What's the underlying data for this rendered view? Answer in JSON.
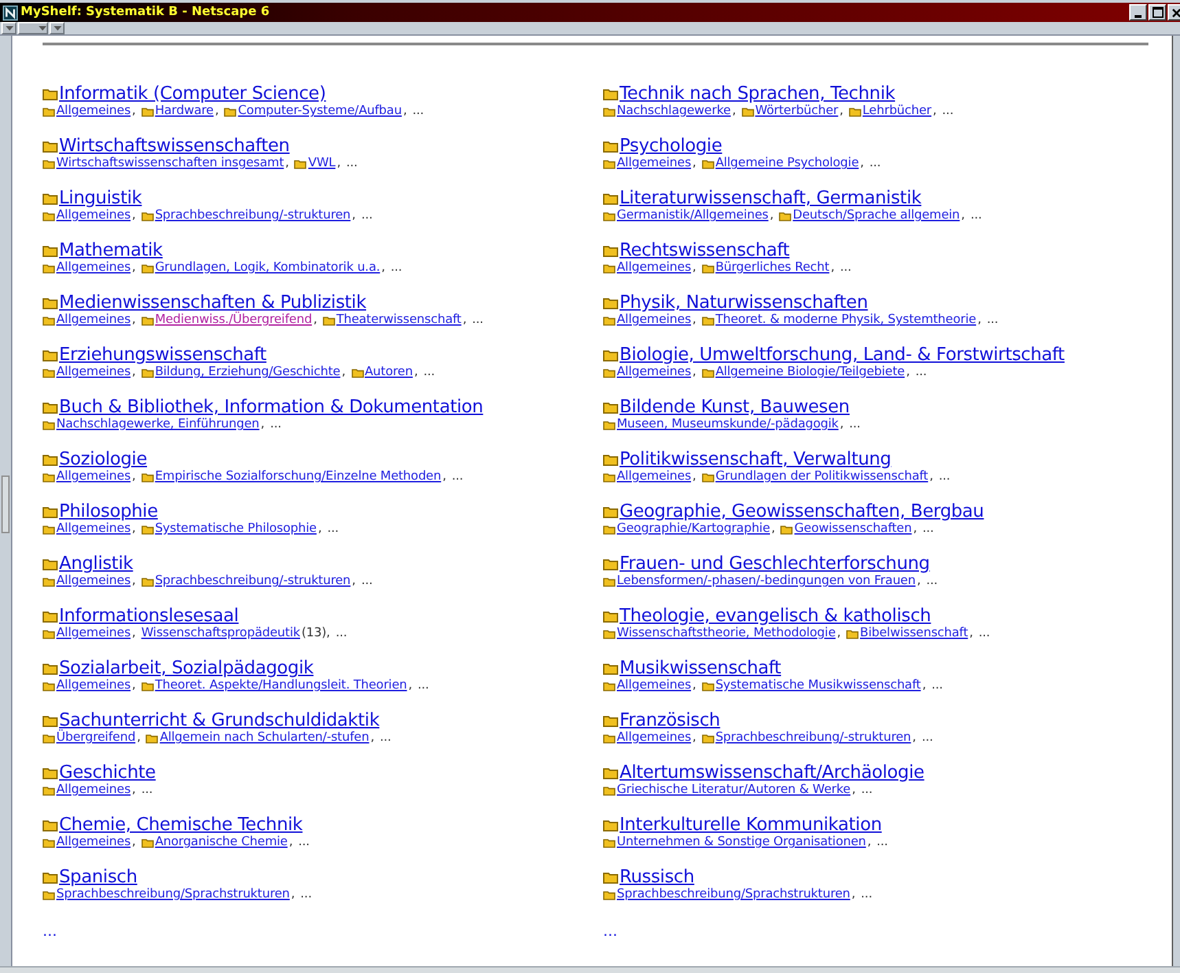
{
  "window": {
    "title": "MyShelf: Systematik B - Netscape 6"
  },
  "columns": [
    {
      "categories": [
        {
          "title": "Informatik (Computer Science)",
          "subs": [
            {
              "label": "Allgemeines",
              "folder": true,
              "visited": false,
              "suffix": ","
            },
            {
              "label": "Hardware",
              "folder": true,
              "visited": false,
              "suffix": ","
            },
            {
              "label": "Computer-Systeme/Aufbau",
              "folder": true,
              "visited": false,
              "suffix": ","
            }
          ],
          "tail": "..."
        },
        {
          "title": "Wirtschaftswissenschaften",
          "subs": [
            {
              "label": "Wirtschaftswissenschaften insgesamt",
              "folder": true,
              "visited": false,
              "suffix": ","
            },
            {
              "label": "VWL",
              "folder": true,
              "visited": false,
              "suffix": ","
            }
          ],
          "tail": "..."
        },
        {
          "title": "Linguistik",
          "subs": [
            {
              "label": "Allgemeines",
              "folder": true,
              "visited": false,
              "suffix": ","
            },
            {
              "label": "Sprachbeschreibung/-strukturen",
              "folder": true,
              "visited": false,
              "suffix": ","
            }
          ],
          "tail": "..."
        },
        {
          "title": "Mathematik",
          "subs": [
            {
              "label": "Allgemeines",
              "folder": true,
              "visited": false,
              "suffix": ","
            },
            {
              "label": "Grundlagen, Logik, Kombinatorik u.a.",
              "folder": true,
              "visited": false,
              "suffix": ","
            }
          ],
          "tail": "..."
        },
        {
          "title": "Medienwissenschaften & Publizistik",
          "subs": [
            {
              "label": "Allgemeines",
              "folder": true,
              "visited": false,
              "suffix": ","
            },
            {
              "label": "Medienwiss./Übergreifend",
              "folder": true,
              "visited": true,
              "suffix": ","
            },
            {
              "label": "Theaterwissenschaft",
              "folder": true,
              "visited": false,
              "suffix": ","
            }
          ],
          "tail": "..."
        },
        {
          "title": "Erziehungswissenschaft",
          "subs": [
            {
              "label": "Allgemeines",
              "folder": true,
              "visited": false,
              "suffix": ","
            },
            {
              "label": "Bildung, Erziehung/Geschichte",
              "folder": true,
              "visited": false,
              "suffix": ","
            },
            {
              "label": "Autoren",
              "folder": true,
              "visited": false,
              "suffix": ","
            }
          ],
          "tail": "..."
        },
        {
          "title": "Buch & Bibliothek, Information & Dokumentation",
          "subs": [
            {
              "label": "Nachschlagewerke, Einführungen",
              "folder": true,
              "visited": false,
              "suffix": ","
            }
          ],
          "tail": "..."
        },
        {
          "title": "Soziologie",
          "subs": [
            {
              "label": "Allgemeines",
              "folder": true,
              "visited": false,
              "suffix": ","
            },
            {
              "label": "Empirische Sozialforschung/Einzelne Methoden",
              "folder": true,
              "visited": false,
              "suffix": ","
            }
          ],
          "tail": "..."
        },
        {
          "title": "Philosophie",
          "subs": [
            {
              "label": "Allgemeines",
              "folder": true,
              "visited": false,
              "suffix": ","
            },
            {
              "label": "Systematische Philosophie",
              "folder": true,
              "visited": false,
              "suffix": ","
            }
          ],
          "tail": "..."
        },
        {
          "title": "Anglistik",
          "subs": [
            {
              "label": "Allgemeines",
              "folder": true,
              "visited": false,
              "suffix": ","
            },
            {
              "label": "Sprachbeschreibung/-strukturen",
              "folder": true,
              "visited": false,
              "suffix": ","
            }
          ],
          "tail": "..."
        },
        {
          "title": "Informationslesesaal",
          "subs": [
            {
              "label": "Allgemeines",
              "folder": true,
              "visited": false,
              "suffix": ","
            },
            {
              "label": "Wissenschaftspropädeutik",
              "folder": false,
              "visited": false,
              "suffix": "(13),"
            }
          ],
          "tail": "..."
        },
        {
          "title": "Sozialarbeit, Sozialpädagogik",
          "subs": [
            {
              "label": "Allgemeines",
              "folder": true,
              "visited": false,
              "suffix": ","
            },
            {
              "label": "Theoret. Aspekte/Handlungsleit. Theorien",
              "folder": true,
              "visited": false,
              "suffix": ","
            }
          ],
          "tail": "..."
        },
        {
          "title": "Sachunterricht & Grundschuldidaktik",
          "subs": [
            {
              "label": "Übergreifend",
              "folder": true,
              "visited": false,
              "suffix": ","
            },
            {
              "label": "Allgemein nach Schularten/-stufen",
              "folder": true,
              "visited": false,
              "suffix": ","
            }
          ],
          "tail": "..."
        },
        {
          "title": "Geschichte",
          "subs": [
            {
              "label": "Allgemeines",
              "folder": true,
              "visited": false,
              "suffix": ","
            }
          ],
          "tail": "..."
        },
        {
          "title": "Chemie, Chemische Technik",
          "subs": [
            {
              "label": "Allgemeines",
              "folder": true,
              "visited": false,
              "suffix": ","
            },
            {
              "label": "Anorganische Chemie",
              "folder": true,
              "visited": false,
              "suffix": ","
            }
          ],
          "tail": "..."
        },
        {
          "title": "Spanisch",
          "subs": [
            {
              "label": "Sprachbeschreibung/Sprachstrukturen",
              "folder": true,
              "visited": false,
              "suffix": ","
            }
          ],
          "tail": "..."
        }
      ],
      "more": "..."
    },
    {
      "categories": [
        {
          "title": "Technik nach Sprachen, Technik",
          "subs": [
            {
              "label": "Nachschlagewerke",
              "folder": true,
              "visited": false,
              "suffix": ","
            },
            {
              "label": "Wörterbücher",
              "folder": true,
              "visited": false,
              "suffix": ","
            },
            {
              "label": "Lehrbücher",
              "folder": true,
              "visited": false,
              "suffix": ","
            }
          ],
          "tail": "..."
        },
        {
          "title": "Psychologie",
          "subs": [
            {
              "label": "Allgemeines",
              "folder": true,
              "visited": false,
              "suffix": ","
            },
            {
              "label": "Allgemeine Psychologie",
              "folder": true,
              "visited": false,
              "suffix": ","
            }
          ],
          "tail": "..."
        },
        {
          "title": "Literaturwissenschaft, Germanistik",
          "subs": [
            {
              "label": "Germanistik/Allgemeines",
              "folder": true,
              "visited": false,
              "suffix": ","
            },
            {
              "label": "Deutsch/Sprache allgemein",
              "folder": true,
              "visited": false,
              "suffix": ","
            }
          ],
          "tail": "..."
        },
        {
          "title": "Rechtswissenschaft",
          "subs": [
            {
              "label": "Allgemeines",
              "folder": true,
              "visited": false,
              "suffix": ","
            },
            {
              "label": "Bürgerliches Recht",
              "folder": true,
              "visited": false,
              "suffix": ","
            }
          ],
          "tail": "..."
        },
        {
          "title": "Physik, Naturwissenschaften",
          "subs": [
            {
              "label": "Allgemeines",
              "folder": true,
              "visited": false,
              "suffix": ","
            },
            {
              "label": "Theoret. & moderne Physik, Systemtheorie",
              "folder": true,
              "visited": false,
              "suffix": ","
            }
          ],
          "tail": "..."
        },
        {
          "title": "Biologie, Umweltforschung, Land- & Forstwirtschaft",
          "subs": [
            {
              "label": "Allgemeines",
              "folder": true,
              "visited": false,
              "suffix": ","
            },
            {
              "label": "Allgemeine Biologie/Teilgebiete",
              "folder": true,
              "visited": false,
              "suffix": ","
            }
          ],
          "tail": "..."
        },
        {
          "title": "Bildende Kunst, Bauwesen",
          "subs": [
            {
              "label": "Museen, Museumskunde/-pädagogik",
              "folder": true,
              "visited": false,
              "suffix": ","
            }
          ],
          "tail": "..."
        },
        {
          "title": "Politikwissenschaft, Verwaltung",
          "subs": [
            {
              "label": "Allgemeines",
              "folder": true,
              "visited": false,
              "suffix": ","
            },
            {
              "label": "Grundlagen der Politikwissenschaft",
              "folder": true,
              "visited": false,
              "suffix": ","
            }
          ],
          "tail": "..."
        },
        {
          "title": "Geographie, Geowissenschaften, Bergbau",
          "subs": [
            {
              "label": "Geographie/Kartographie",
              "folder": true,
              "visited": false,
              "suffix": ","
            },
            {
              "label": "Geowissenschaften",
              "folder": true,
              "visited": false,
              "suffix": ","
            }
          ],
          "tail": "..."
        },
        {
          "title": "Frauen- und Geschlechterforschung",
          "subs": [
            {
              "label": "Lebensformen/-phasen/-bedingungen von Frauen",
              "folder": true,
              "visited": false,
              "suffix": ","
            }
          ],
          "tail": "..."
        },
        {
          "title": "Theologie, evangelisch & katholisch",
          "subs": [
            {
              "label": "Wissenschaftstheorie, Methodologie",
              "folder": true,
              "visited": false,
              "suffix": ","
            },
            {
              "label": "Bibelwissenschaft",
              "folder": true,
              "visited": false,
              "suffix": ","
            }
          ],
          "tail": "..."
        },
        {
          "title": "Musikwissenschaft",
          "subs": [
            {
              "label": "Allgemeines",
              "folder": true,
              "visited": false,
              "suffix": ","
            },
            {
              "label": "Systematische Musikwissenschaft",
              "folder": true,
              "visited": false,
              "suffix": ","
            }
          ],
          "tail": "..."
        },
        {
          "title": "Französisch",
          "subs": [
            {
              "label": "Allgemeines",
              "folder": true,
              "visited": false,
              "suffix": ","
            },
            {
              "label": "Sprachbeschreibung/-strukturen",
              "folder": true,
              "visited": false,
              "suffix": ","
            }
          ],
          "tail": "..."
        },
        {
          "title": "Altertumswissenschaft/Archäologie",
          "subs": [
            {
              "label": "Griechische Literatur/Autoren & Werke",
              "folder": true,
              "visited": false,
              "suffix": ","
            }
          ],
          "tail": "..."
        },
        {
          "title": "Interkulturelle Kommunikation",
          "subs": [
            {
              "label": "Unternehmen & Sonstige Organisationen",
              "folder": true,
              "visited": false,
              "suffix": ","
            }
          ],
          "tail": "..."
        },
        {
          "title": "Russisch",
          "subs": [
            {
              "label": "Sprachbeschreibung/Sprachstrukturen",
              "folder": true,
              "visited": false,
              "suffix": ","
            }
          ],
          "tail": "..."
        }
      ],
      "more": "..."
    }
  ]
}
